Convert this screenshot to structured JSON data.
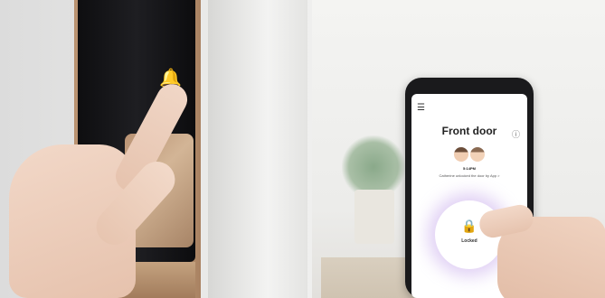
{
  "app": {
    "title": "Front door",
    "time": "5:14PM",
    "activity": "Catherine unlocked the door by App >",
    "status_label": "Locked"
  },
  "icons": {
    "bell": "bell-icon",
    "menu": "menu-icon",
    "info": "info-icon",
    "padlock": "padlock-icon"
  },
  "colors": {
    "bell_accent": "#e06a3a",
    "lock_glow": "#ba96e6"
  }
}
